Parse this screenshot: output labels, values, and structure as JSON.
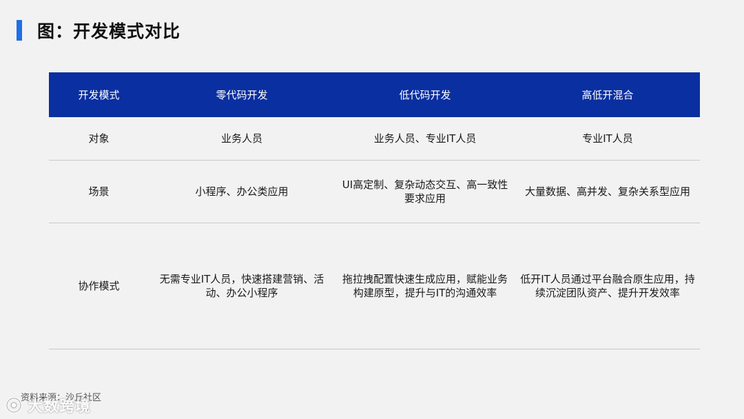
{
  "title": "图：开发模式对比",
  "table": {
    "headers": [
      "开发模式",
      "零代码开发",
      "低代码开发",
      "高低开混合"
    ],
    "rows": [
      [
        "对象",
        "业务人员",
        "业务人员、专业IT人员",
        "专业IT人员"
      ],
      [
        "场景",
        "小程序、办公类应用",
        "UI高定制、复杂动态交互、高一致性要求应用",
        "大量数据、高并发、复杂关系型应用"
      ],
      [
        "协作模式",
        "无需专业IT人员，快速搭建营销、活动、办公小程序",
        "拖拉拽配置快速生成应用，赋能业务构建原型，提升与IT的沟通效率",
        "低开IT人员通过平台融合原生应用，持续沉淀团队资产、提升开发效率"
      ]
    ]
  },
  "source": "资料来源：沙丘社区",
  "watermark": "大数跨境",
  "colors": {
    "accent": "#1f6fe5",
    "header_bg": "#0a2fa0"
  }
}
